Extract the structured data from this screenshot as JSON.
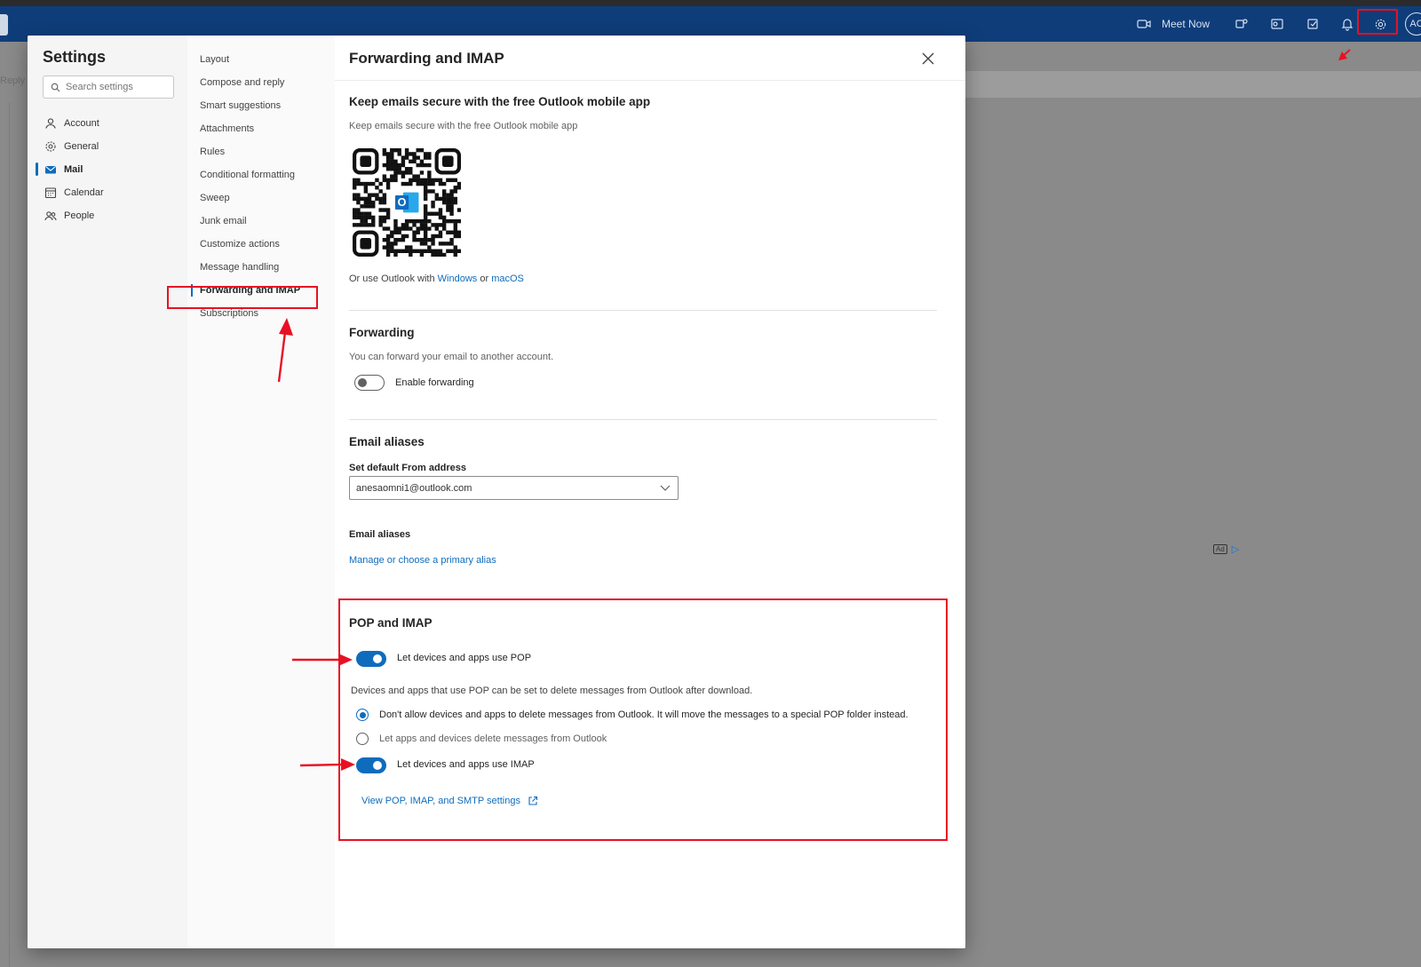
{
  "topbar": {
    "meet_now_label": "Meet Now",
    "avatar_initials": "AC",
    "icons": [
      "video-icon",
      "teams-icon",
      "outlook-icon",
      "note-icon",
      "bell-icon",
      "gear-icon"
    ]
  },
  "background": {
    "reply_label": "Reply",
    "ad_label": "Ad"
  },
  "settings": {
    "title": "Settings",
    "search_placeholder": "Search settings",
    "categories": [
      {
        "label": "Account",
        "icon": "person-icon"
      },
      {
        "label": "General",
        "icon": "gear-icon"
      },
      {
        "label": "Mail",
        "icon": "mail-icon",
        "active": true
      },
      {
        "label": "Calendar",
        "icon": "calendar-icon"
      },
      {
        "label": "People",
        "icon": "people-icon"
      }
    ],
    "mail_sections": [
      "Layout",
      "Compose and reply",
      "Smart suggestions",
      "Attachments",
      "Rules",
      "Conditional formatting",
      "Sweep",
      "Junk email",
      "Customize actions",
      "Message handling",
      "Forwarding and IMAP",
      "Subscriptions"
    ],
    "active_section": "Forwarding and IMAP"
  },
  "content": {
    "title": "Forwarding and IMAP",
    "mobile": {
      "heading": "Keep emails secure with the free Outlook mobile app",
      "description": "Keep emails secure with the free Outlook mobile app",
      "or_use_prefix": "Or use Outlook with",
      "windows_link": "Windows",
      "or_word": "or",
      "macos_link": "macOS"
    },
    "forwarding": {
      "heading": "Forwarding",
      "description": "You can forward your email to another account.",
      "toggle_label": "Enable forwarding",
      "enabled": false
    },
    "aliases": {
      "heading": "Email aliases",
      "default_from_label": "Set default From address",
      "default_from_value": "anesaomni1@outlook.com",
      "aliases_label": "Email aliases",
      "manage_link": "Manage or choose a primary alias"
    },
    "pop_imap": {
      "heading": "POP and IMAP",
      "pop_toggle_label": "Let devices and apps use POP",
      "pop_enabled": true,
      "pop_note": "Devices and apps that use POP can be set to delete messages from Outlook after download.",
      "radio_options": [
        "Don't allow devices and apps to delete messages from Outlook. It will move the messages to a special POP folder instead.",
        "Let apps and devices delete messages from Outlook"
      ],
      "radio_selected_index": 0,
      "imap_toggle_label": "Let devices and apps use IMAP",
      "imap_enabled": true,
      "view_settings_link": "View POP, IMAP, and SMTP settings"
    }
  },
  "colors": {
    "brand_blue": "#0f6cbd",
    "header_blue": "#0f3d7a",
    "annotation_red": "#e81123"
  }
}
